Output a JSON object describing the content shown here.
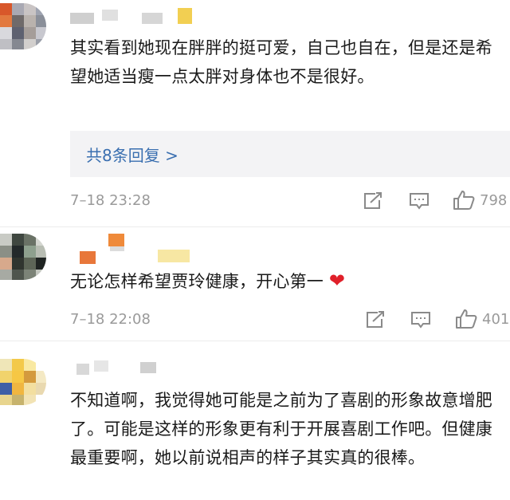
{
  "comments": [
    {
      "text": "其实看到她现在胖胖的挺可爱，自己也自在，但是还是希望她适当瘦一点太胖对身体也不是很好。",
      "replies_link": "共8条回复 >",
      "time": "7–18 23:28",
      "likes": "798",
      "icons": [
        "share-icon",
        "comment-icon",
        "thumbs-up-icon"
      ]
    },
    {
      "text": "无论怎样希望贾玲健康，开心第一",
      "emoji": "❤",
      "time": "7–18 22:08",
      "likes": "401",
      "icons": [
        "share-icon",
        "comment-icon",
        "thumbs-up-icon"
      ]
    },
    {
      "text": "不知道啊，我觉得她可能是之前为了喜剧的形象故意增肥了。可能是这样的形象更有利于开展喜剧工作吧。但健康最重要啊，她以前说相声的样子其实真的很棒。"
    }
  ],
  "colors": {
    "link": "#3a6fb0",
    "meta": "#9a9a9a",
    "heart": "#e0202a",
    "reply_bg": "#f3f3f5"
  }
}
